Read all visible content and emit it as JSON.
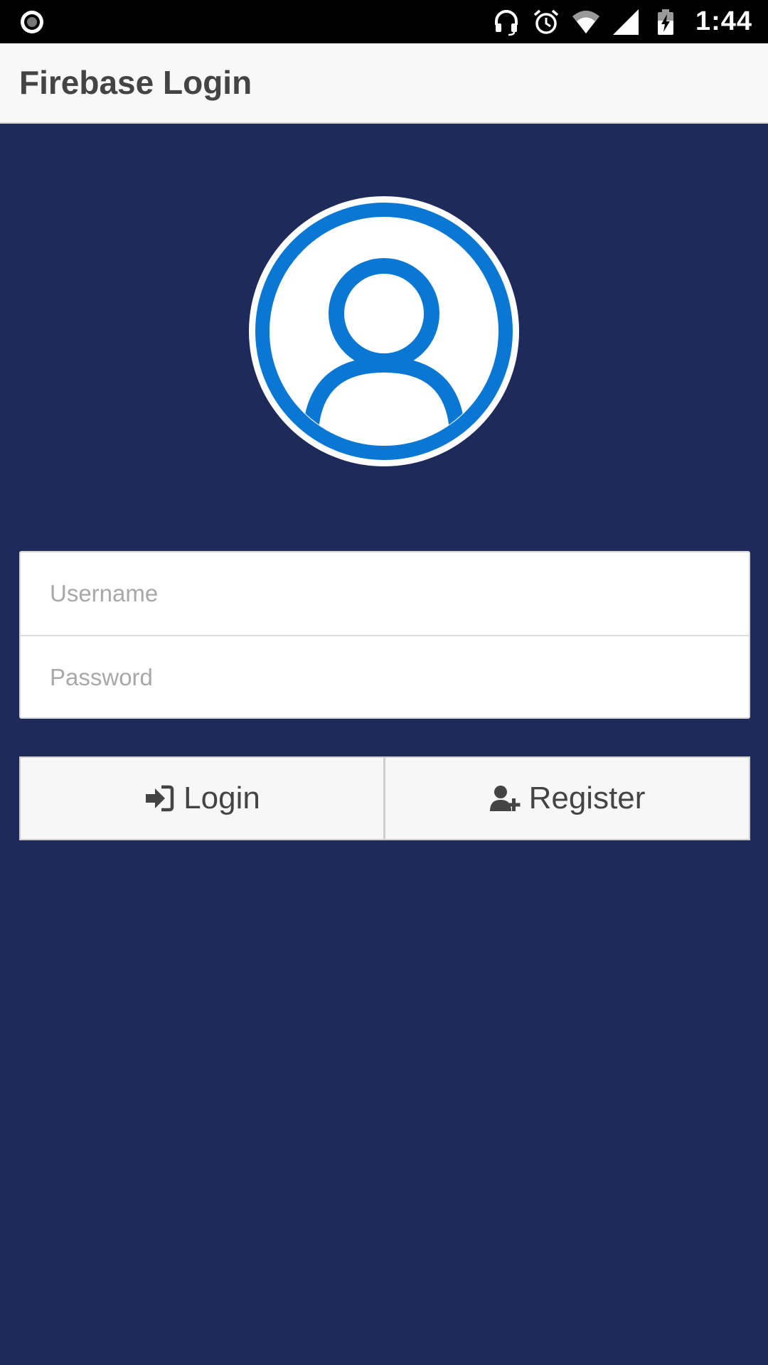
{
  "status_bar": {
    "time": "1:44",
    "icons": [
      "record-icon",
      "headset-icon",
      "alarm-icon",
      "wifi-icon",
      "signal-icon",
      "battery-charging-icon"
    ]
  },
  "app_bar": {
    "title": "Firebase Login"
  },
  "avatar": {
    "icon": "user-avatar-icon",
    "color": "#0a77d5"
  },
  "form": {
    "username": {
      "value": "",
      "placeholder": "Username"
    },
    "password": {
      "value": "",
      "placeholder": "Password"
    }
  },
  "buttons": {
    "login": {
      "label": "Login",
      "icon": "sign-in-icon"
    },
    "register": {
      "label": "Register",
      "icon": "user-plus-icon"
    }
  },
  "colors": {
    "background": "#1e2a59",
    "app_bar": "#f8f8f8",
    "status_bar": "#000000",
    "button_text": "#444444"
  }
}
